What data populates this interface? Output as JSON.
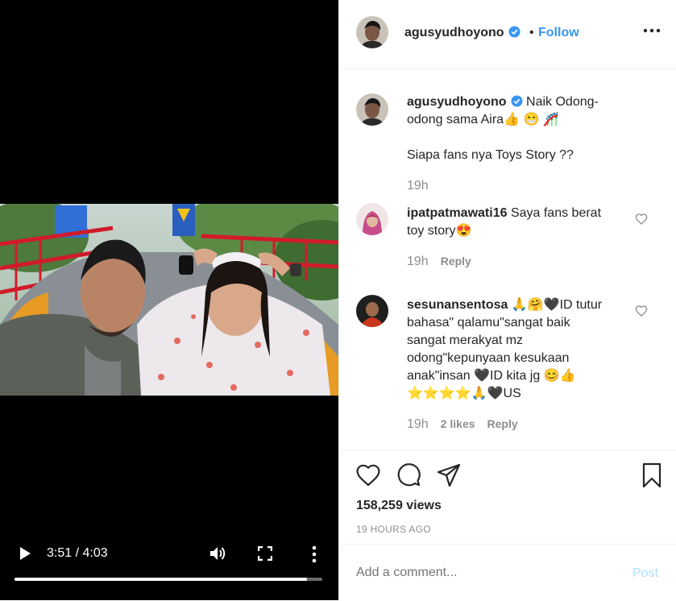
{
  "video": {
    "time": "3:51 / 4:03",
    "progress": 0.95
  },
  "post": {
    "username": "agusyudhoyono",
    "dot": "•",
    "follow_label": "Follow",
    "caption_line1": "Naik Odong-",
    "caption_line2": "odong sama Aira👍 😁 🎢",
    "caption_line3": "Siapa fans nya Toys Story ??",
    "caption_time": "19h"
  },
  "comments": [
    {
      "username": "ipatpatmawati16",
      "line1": "Saya fans berat",
      "line2": "toy story😍",
      "time": "19h",
      "reply": "Reply"
    },
    {
      "username": "sesunansentosa",
      "line1": "🙏🤗🖤ID tutur",
      "line2": "bahasa\" qalamu\"sangat baik",
      "line3": "sangat merakyat mz",
      "line4": "odong\"kepunyaan kesukaan",
      "line5": "anak\"insan 🖤ID kita jg 😊👍",
      "line6": "⭐⭐⭐⭐🙏🖤US",
      "time": "19h",
      "likes": "2 likes",
      "reply": "Reply"
    }
  ],
  "stats": {
    "views": "158,259 views",
    "ago": "19 HOURS AGO"
  },
  "add_comment": {
    "placeholder": "Add a comment...",
    "post_label": "Post"
  },
  "icons": [
    "play-icon",
    "volume-icon",
    "fullscreen-icon",
    "more-vertical-icon",
    "verified-icon",
    "more-horizontal-icon",
    "heart-icon",
    "comment-icon",
    "share-icon",
    "bookmark-icon"
  ],
  "colors": {
    "accent": "#3897f0",
    "muted": "#8e8e8e",
    "post_disabled": "#b2dffc"
  }
}
